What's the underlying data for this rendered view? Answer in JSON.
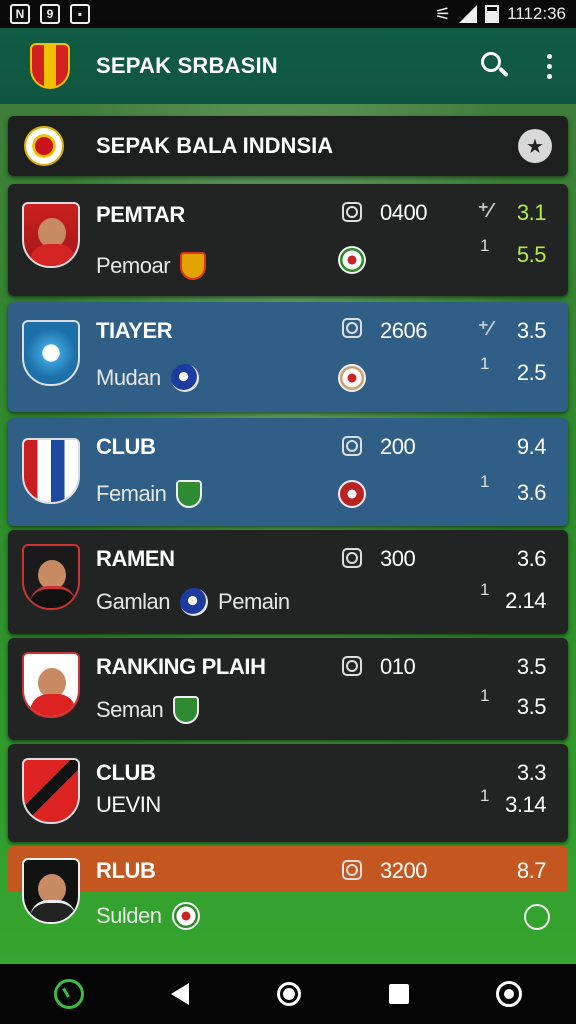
{
  "status_bar": {
    "time": "1112:36",
    "left_icons": [
      "n-icon",
      "location-icon",
      "photo-icon"
    ],
    "right_icons": [
      "wifi-icon",
      "signal-icon",
      "battery-icon"
    ]
  },
  "app_bar": {
    "title": "SEPAK SRBASIN",
    "icons": [
      "search-icon",
      "more-vert-icon"
    ]
  },
  "league": {
    "title": "SEPAK BALA INDNSIA",
    "star_icon": "star-icon"
  },
  "rows": [
    {
      "name": "PEMTAR",
      "sub": "Pemoar",
      "count": "0400",
      "trend": "⁺⁄",
      "one": "1",
      "value_top": "3.1",
      "value_bottom": "5.5"
    },
    {
      "name": "TIAYER",
      "sub": "Mudan",
      "count": "2606",
      "trend": "⁺⁄",
      "one": "1",
      "value_top": "3.5",
      "value_bottom": "2.5"
    },
    {
      "name": "CLUB",
      "sub": "Femain",
      "count": "200",
      "trend": "",
      "one": "1",
      "value_top": "9.4",
      "value_bottom": "3.6"
    },
    {
      "name": "RAMEN",
      "sub": "Gamlan",
      "sub_extra": "Pemain",
      "count": "300",
      "trend": "",
      "one": "1",
      "value_top": "3.6",
      "value_bottom": "2.14"
    },
    {
      "name": "RANKING PLAIH",
      "sub": "Seman",
      "count": "010",
      "trend": "",
      "one": "1",
      "value_top": "3.5",
      "value_bottom": "3.5"
    },
    {
      "name": "CLUB",
      "sub": "UEVIN",
      "count": "",
      "trend": "",
      "one": "1",
      "value_top": "3.3",
      "value_bottom": "3.14"
    },
    {
      "name": "RLUB",
      "sub": "Sulden",
      "count": "3200",
      "trend": "",
      "one": "",
      "value_top": "8.7",
      "value_bottom": ""
    }
  ],
  "nav_bar": {
    "icons": [
      "clock-icon",
      "back-icon",
      "home-icon",
      "recents-icon",
      "assistant-icon"
    ]
  },
  "colors": {
    "app_bar": "#115c44",
    "row_dark": "#222424",
    "row_blue": "#2f5f86",
    "row_orange": "#c45720",
    "accent_green": "#b6e84a"
  }
}
